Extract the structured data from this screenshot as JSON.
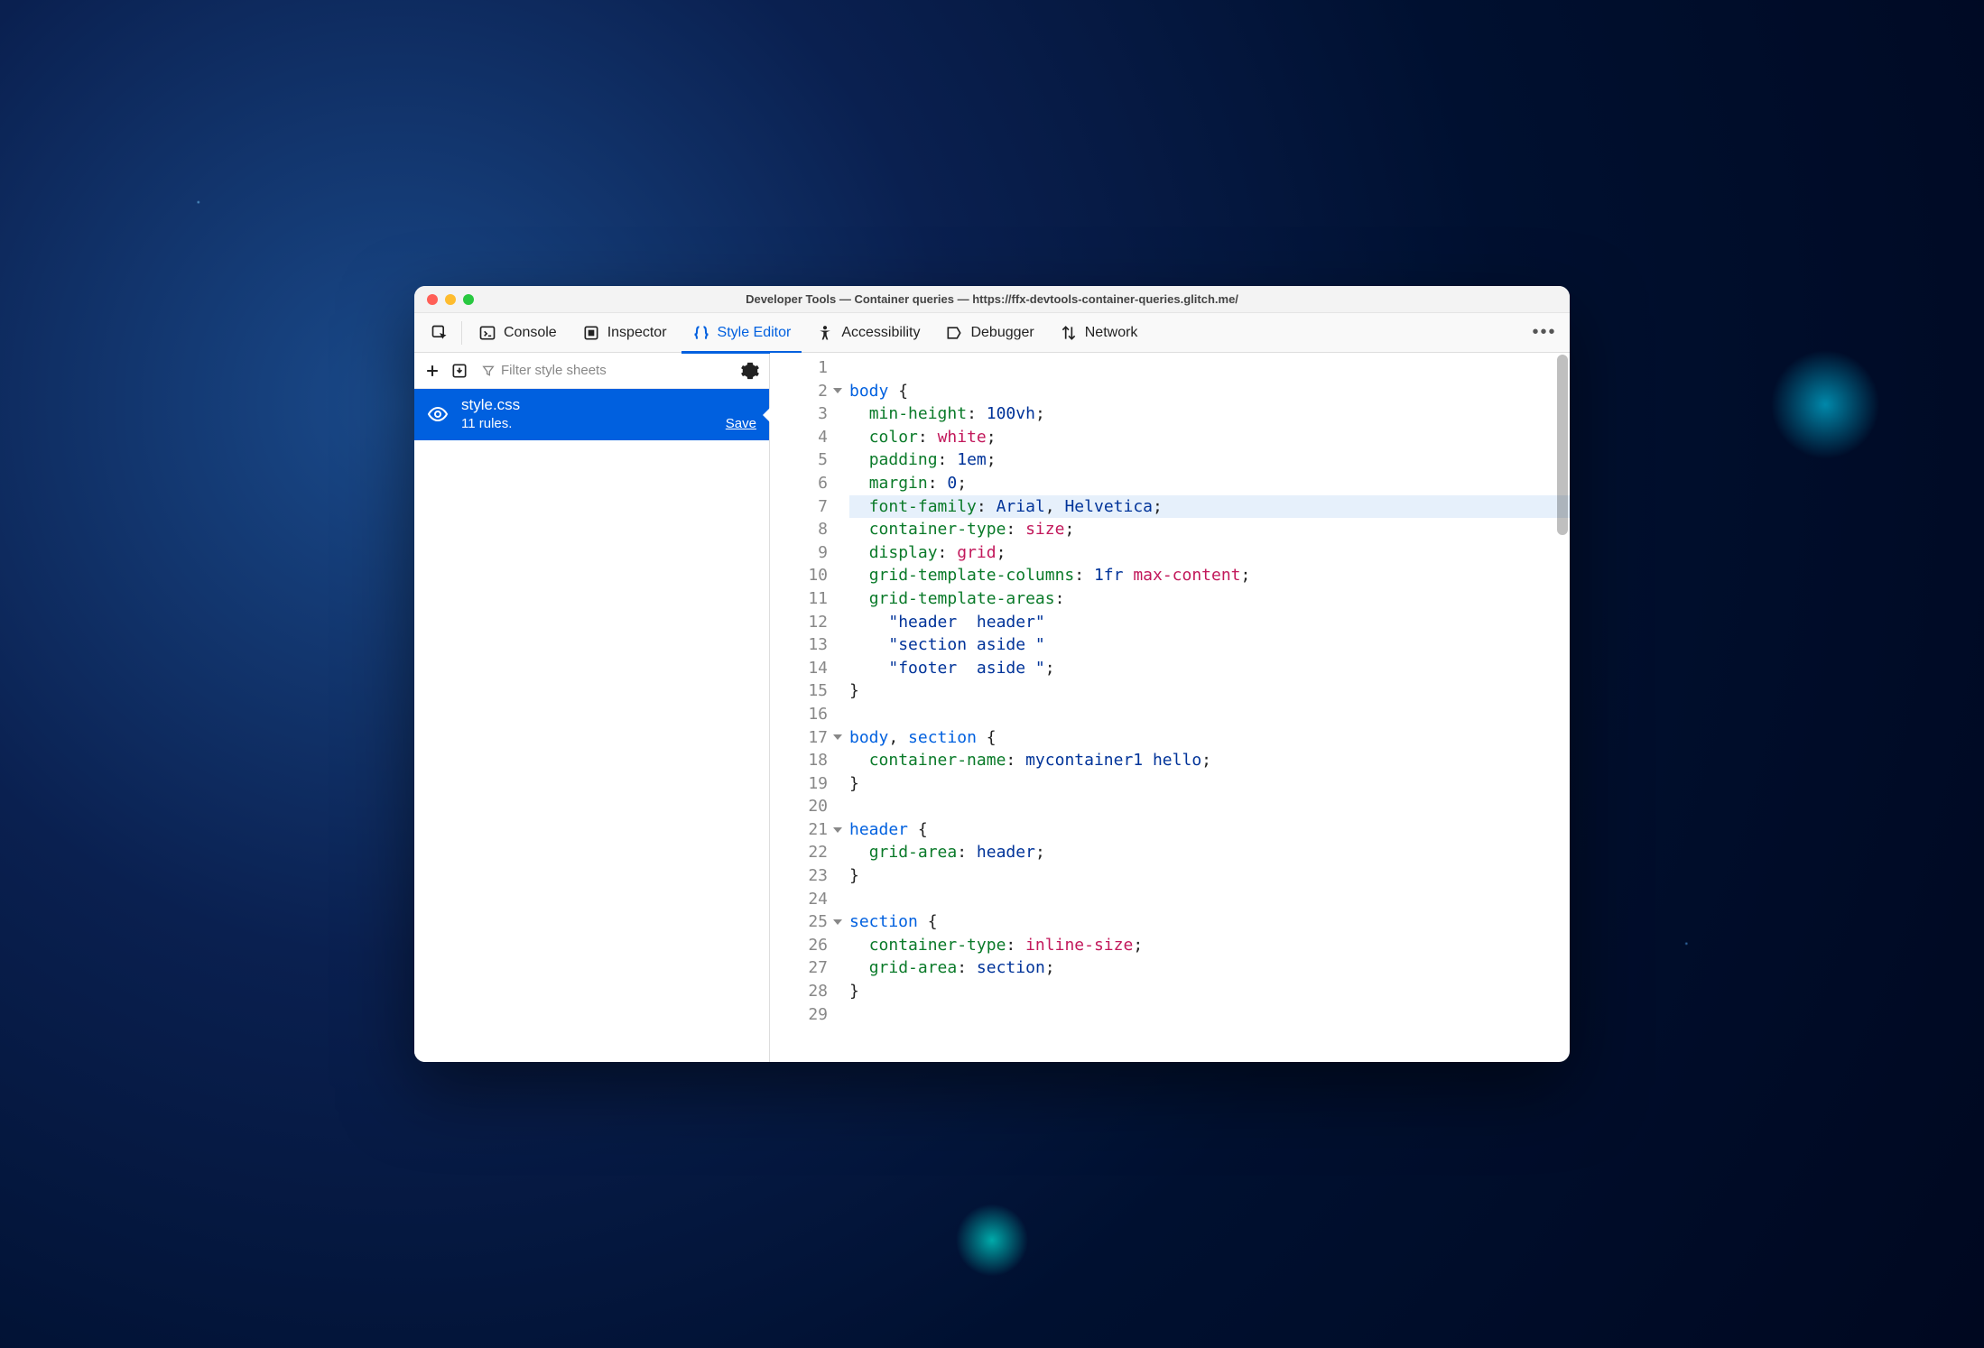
{
  "window": {
    "title": "Developer Tools — Container queries — https://ffx-devtools-container-queries.glitch.me/"
  },
  "toolbar": {
    "tabs": {
      "console": "Console",
      "inspector": "Inspector",
      "style_editor": "Style Editor",
      "accessibility": "Accessibility",
      "debugger": "Debugger",
      "network": "Network"
    }
  },
  "sidebar": {
    "filter_placeholder": "Filter style sheets",
    "sheet": {
      "name": "style.css",
      "rules": "11 rules.",
      "save": "Save"
    }
  },
  "editor": {
    "highlighted_line": 7,
    "lines": [
      {
        "n": 1,
        "t": []
      },
      {
        "n": 2,
        "fold": true,
        "t": [
          [
            "sel",
            "body"
          ],
          [
            "punc",
            " {"
          ]
        ]
      },
      {
        "n": 3,
        "t": [
          [
            "indent",
            "  "
          ],
          [
            "prop",
            "min-height"
          ],
          [
            "punc",
            ": "
          ],
          [
            "val",
            "100vh"
          ],
          [
            "punc",
            ";"
          ]
        ]
      },
      {
        "n": 4,
        "t": [
          [
            "indent",
            "  "
          ],
          [
            "prop",
            "color"
          ],
          [
            "punc",
            ": "
          ],
          [
            "kw",
            "white"
          ],
          [
            "punc",
            ";"
          ]
        ]
      },
      {
        "n": 5,
        "t": [
          [
            "indent",
            "  "
          ],
          [
            "prop",
            "padding"
          ],
          [
            "punc",
            ": "
          ],
          [
            "val",
            "1em"
          ],
          [
            "punc",
            ";"
          ]
        ]
      },
      {
        "n": 6,
        "t": [
          [
            "indent",
            "  "
          ],
          [
            "prop",
            "margin"
          ],
          [
            "punc",
            ": "
          ],
          [
            "val",
            "0"
          ],
          [
            "punc",
            ";"
          ]
        ]
      },
      {
        "n": 7,
        "t": [
          [
            "indent",
            "  "
          ],
          [
            "prop",
            "font-family"
          ],
          [
            "punc",
            ": "
          ],
          [
            "val",
            "Arial"
          ],
          [
            "punc",
            ", "
          ],
          [
            "val",
            "Helvetica"
          ],
          [
            "punc",
            ";"
          ]
        ]
      },
      {
        "n": 8,
        "t": [
          [
            "indent",
            "  "
          ],
          [
            "prop",
            "container-type"
          ],
          [
            "punc",
            ": "
          ],
          [
            "kw",
            "size"
          ],
          [
            "punc",
            ";"
          ]
        ]
      },
      {
        "n": 9,
        "t": [
          [
            "indent",
            "  "
          ],
          [
            "prop",
            "display"
          ],
          [
            "punc",
            ": "
          ],
          [
            "kw",
            "grid"
          ],
          [
            "punc",
            ";"
          ]
        ]
      },
      {
        "n": 10,
        "t": [
          [
            "indent",
            "  "
          ],
          [
            "prop",
            "grid-template-columns"
          ],
          [
            "punc",
            ": "
          ],
          [
            "val",
            "1fr "
          ],
          [
            "kw",
            "max-content"
          ],
          [
            "punc",
            ";"
          ]
        ]
      },
      {
        "n": 11,
        "t": [
          [
            "indent",
            "  "
          ],
          [
            "prop",
            "grid-template-areas"
          ],
          [
            "punc",
            ":"
          ]
        ]
      },
      {
        "n": 12,
        "t": [
          [
            "indent",
            "    "
          ],
          [
            "str",
            "\"header  header\""
          ]
        ]
      },
      {
        "n": 13,
        "t": [
          [
            "indent",
            "    "
          ],
          [
            "str",
            "\"section aside \""
          ]
        ]
      },
      {
        "n": 14,
        "t": [
          [
            "indent",
            "    "
          ],
          [
            "str",
            "\"footer  aside \""
          ],
          [
            "punc",
            ";"
          ]
        ]
      },
      {
        "n": 15,
        "t": [
          [
            "punc",
            "}"
          ]
        ]
      },
      {
        "n": 16,
        "t": []
      },
      {
        "n": 17,
        "fold": true,
        "t": [
          [
            "sel",
            "body"
          ],
          [
            "punc",
            ", "
          ],
          [
            "sel",
            "section"
          ],
          [
            "punc",
            " {"
          ]
        ]
      },
      {
        "n": 18,
        "t": [
          [
            "indent",
            "  "
          ],
          [
            "prop",
            "container-name"
          ],
          [
            "punc",
            ": "
          ],
          [
            "val",
            "mycontainer1 hello"
          ],
          [
            "punc",
            ";"
          ]
        ]
      },
      {
        "n": 19,
        "t": [
          [
            "punc",
            "}"
          ]
        ]
      },
      {
        "n": 20,
        "t": []
      },
      {
        "n": 21,
        "fold": true,
        "t": [
          [
            "sel",
            "header"
          ],
          [
            "punc",
            " {"
          ]
        ]
      },
      {
        "n": 22,
        "t": [
          [
            "indent",
            "  "
          ],
          [
            "prop",
            "grid-area"
          ],
          [
            "punc",
            ": "
          ],
          [
            "val",
            "header"
          ],
          [
            "punc",
            ";"
          ]
        ]
      },
      {
        "n": 23,
        "t": [
          [
            "punc",
            "}"
          ]
        ]
      },
      {
        "n": 24,
        "t": []
      },
      {
        "n": 25,
        "fold": true,
        "t": [
          [
            "sel",
            "section"
          ],
          [
            "punc",
            " {"
          ]
        ]
      },
      {
        "n": 26,
        "t": [
          [
            "indent",
            "  "
          ],
          [
            "prop",
            "container-type"
          ],
          [
            "punc",
            ": "
          ],
          [
            "kw",
            "inline-size"
          ],
          [
            "punc",
            ";"
          ]
        ]
      },
      {
        "n": 27,
        "t": [
          [
            "indent",
            "  "
          ],
          [
            "prop",
            "grid-area"
          ],
          [
            "punc",
            ": "
          ],
          [
            "val",
            "section"
          ],
          [
            "punc",
            ";"
          ]
        ]
      },
      {
        "n": 28,
        "t": [
          [
            "punc",
            "}"
          ]
        ]
      },
      {
        "n": 29,
        "t": []
      }
    ]
  }
}
